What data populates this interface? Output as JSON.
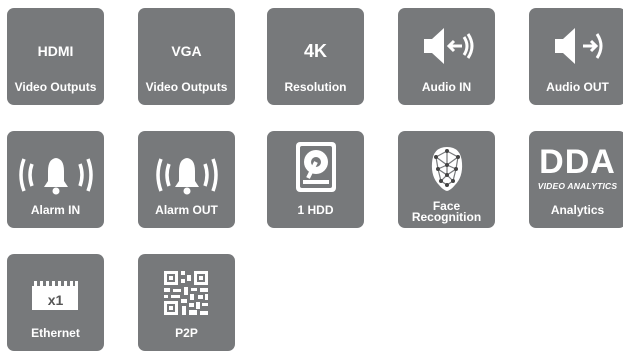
{
  "tiles": [
    {
      "id": "hdmi",
      "top": "HDMI",
      "label": "Video Outputs",
      "icon": "text"
    },
    {
      "id": "vga",
      "top": "VGA",
      "label": "Video Outputs",
      "icon": "text"
    },
    {
      "id": "4k",
      "top": "4K",
      "label": "Resolution",
      "icon": "text"
    },
    {
      "id": "audio-in",
      "label": "Audio IN",
      "icon": "speaker-in-icon"
    },
    {
      "id": "audio-out",
      "label": "Audio OUT",
      "icon": "speaker-out-icon"
    },
    {
      "id": "alarm-in",
      "label": "Alarm IN",
      "icon": "bell-in-icon"
    },
    {
      "id": "alarm-out",
      "label": "Alarm OUT",
      "icon": "bell-out-icon"
    },
    {
      "id": "hdd",
      "label": "1 HDD",
      "icon": "hard-drive-icon"
    },
    {
      "id": "face",
      "label_line1": "Face",
      "label_line2": "Recognition",
      "icon": "face-mesh-icon"
    },
    {
      "id": "dda",
      "logo": "DDA",
      "logo_sub": "VIDEO ANALYTICS",
      "label": "Analytics",
      "icon": "dda-logo"
    },
    {
      "id": "ethernet",
      "port_count": "x1",
      "label": "Ethernet",
      "icon": "ethernet-port-icon"
    },
    {
      "id": "p2p",
      "label": "P2P",
      "icon": "qr-code-icon"
    }
  ],
  "colors": {
    "tile": "#77797b",
    "text": "#ffffff"
  }
}
